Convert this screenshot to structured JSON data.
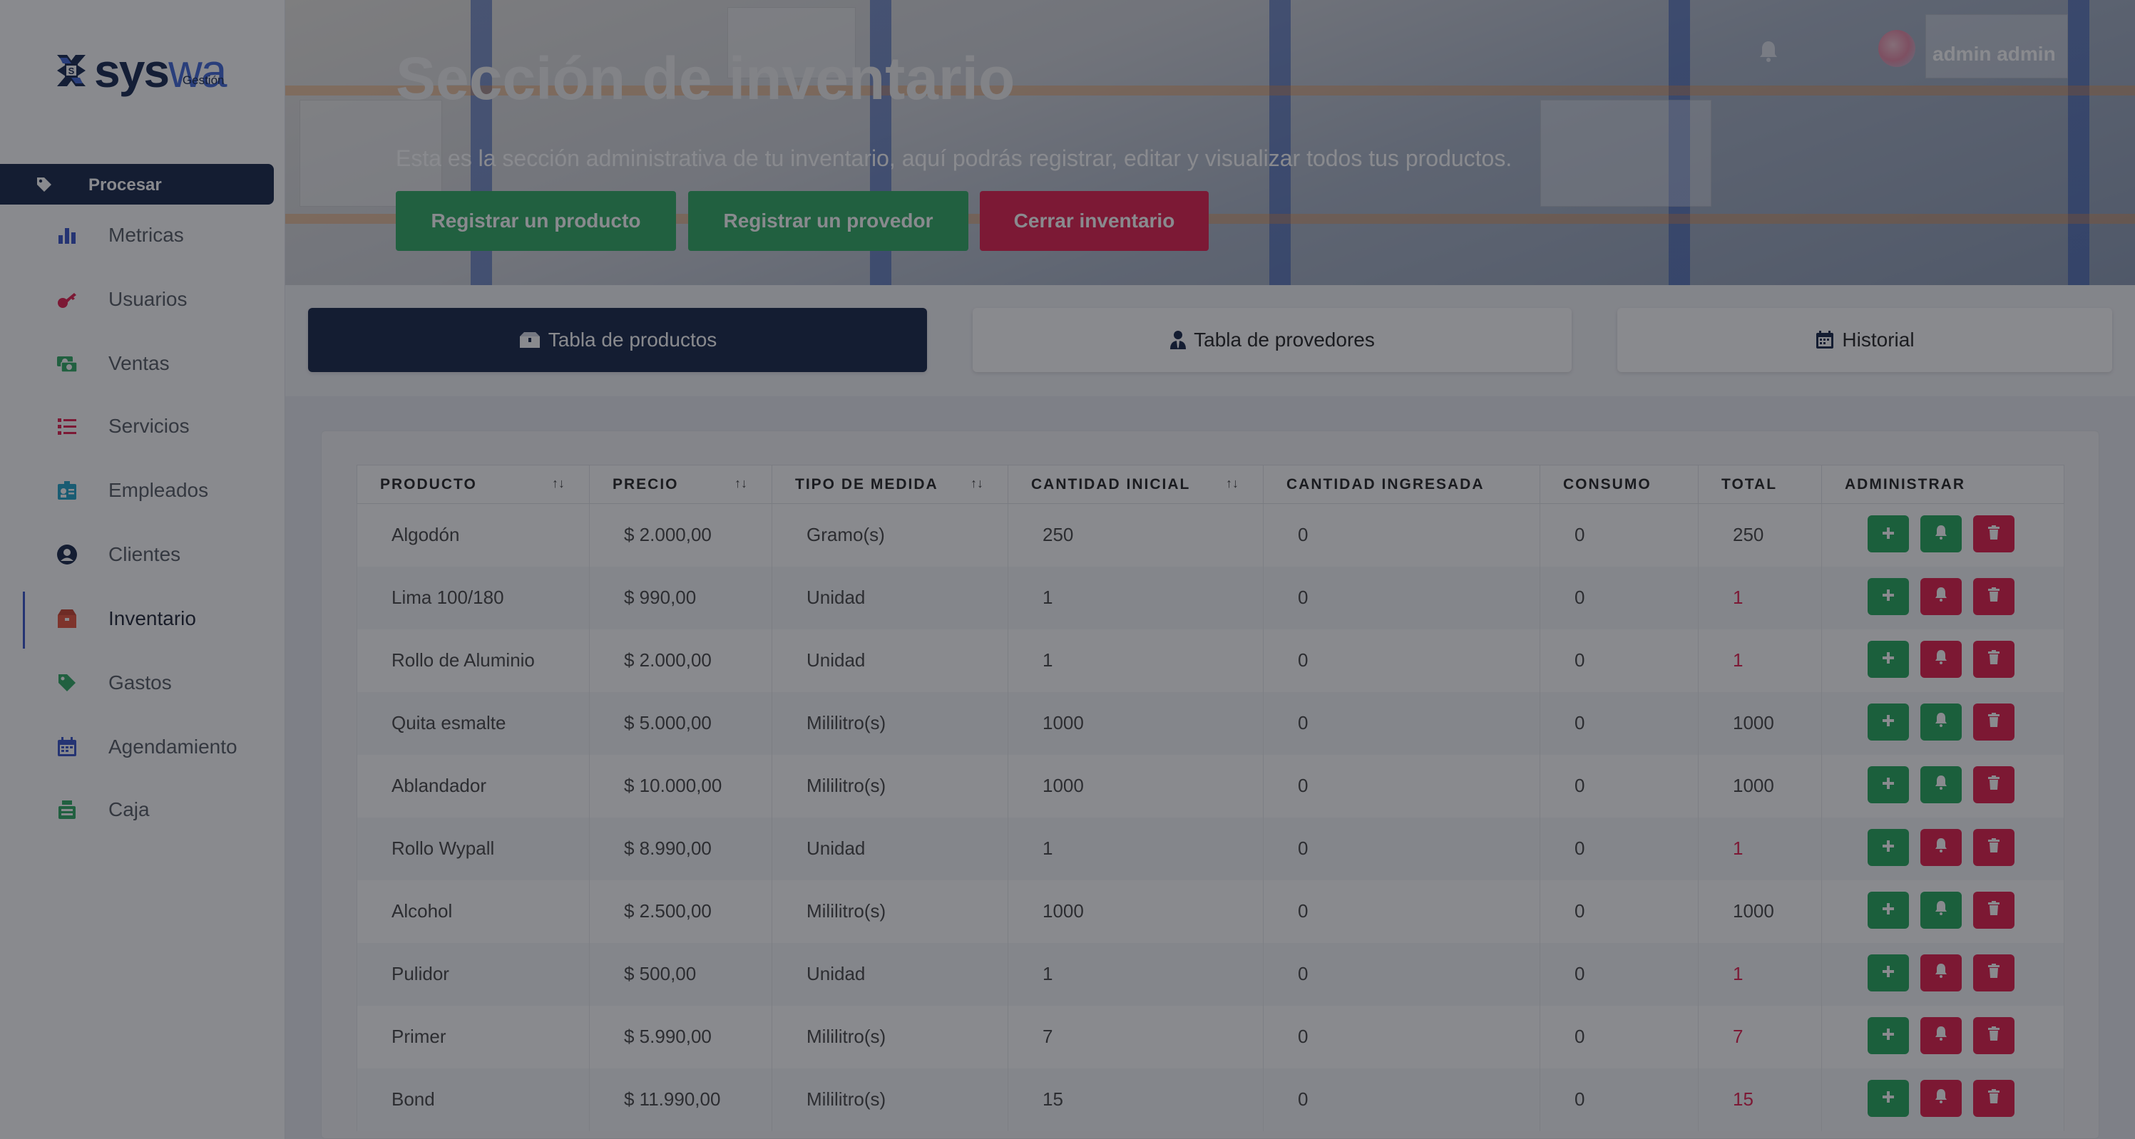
{
  "brand": {
    "name_part1": "sys",
    "name_part2": "wa",
    "sub": "Gestión"
  },
  "sidebar": {
    "procesar_label": "Procesar",
    "items": [
      {
        "label": "Metricas",
        "icon": "bar-chart-icon",
        "color": "#3652c8"
      },
      {
        "label": "Usuarios",
        "icon": "users-key-icon",
        "color": "#e51d4c"
      },
      {
        "label": "Ventas",
        "icon": "money-icon",
        "color": "#2eaa62"
      },
      {
        "label": "Servicios",
        "icon": "list-icon",
        "color": "#e51d4c"
      },
      {
        "label": "Empleados",
        "icon": "id-badge-icon",
        "color": "#1fa3c8"
      },
      {
        "label": "Clientes",
        "icon": "user-circle-icon",
        "color": "#152446"
      },
      {
        "label": "Inventario",
        "icon": "box-icon",
        "color": "#e8533a"
      },
      {
        "label": "Gastos",
        "icon": "tag-icon",
        "color": "#2eaa62"
      },
      {
        "label": "Agendamiento",
        "icon": "calendar-icon",
        "color": "#3652c8"
      },
      {
        "label": "Caja",
        "icon": "cash-register-icon",
        "color": "#2eaa62"
      }
    ],
    "active": "Inventario"
  },
  "header": {
    "title": "Sección de inventario",
    "subtitle": "Esta es la sección administrativa de tu inventario, aquí podrás registrar, editar y visualizar todos tus productos.",
    "buttons": {
      "register_product": "Registrar un producto",
      "register_provider": "Registrar un provedor",
      "close_inventory": "Cerrar inventario"
    },
    "user": "admin admin"
  },
  "tabs": {
    "products": "Tabla de productos",
    "providers": "Tabla de provedores",
    "history": "Historial"
  },
  "table": {
    "columns": [
      "PRODUCTO",
      "PRECIO",
      "TIPO DE MEDIDA",
      "CANTIDAD INICIAL",
      "CANTIDAD INGRESADA",
      "CONSUMO",
      "TOTAL",
      "ADMINISTRAR"
    ],
    "sort_glyph": "↑↓",
    "rows": [
      {
        "producto": "Algodón",
        "precio": "$ 2.000,00",
        "medida": "Gramo(s)",
        "inicial": "250",
        "ingresada": "0",
        "consumo": "0",
        "total": "250",
        "low": false
      },
      {
        "producto": "Lima 100/180",
        "precio": "$ 990,00",
        "medida": "Unidad",
        "inicial": "1",
        "ingresada": "0",
        "consumo": "0",
        "total": "1",
        "low": true
      },
      {
        "producto": "Rollo de Aluminio",
        "precio": "$ 2.000,00",
        "medida": "Unidad",
        "inicial": "1",
        "ingresada": "0",
        "consumo": "0",
        "total": "1",
        "low": true
      },
      {
        "producto": "Quita esmalte",
        "precio": "$ 5.000,00",
        "medida": "Mililitro(s)",
        "inicial": "1000",
        "ingresada": "0",
        "consumo": "0",
        "total": "1000",
        "low": false
      },
      {
        "producto": "Ablandador",
        "precio": "$ 10.000,00",
        "medida": "Mililitro(s)",
        "inicial": "1000",
        "ingresada": "0",
        "consumo": "0",
        "total": "1000",
        "low": false
      },
      {
        "producto": "Rollo Wypall",
        "precio": "$ 8.990,00",
        "medida": "Unidad",
        "inicial": "1",
        "ingresada": "0",
        "consumo": "0",
        "total": "1",
        "low": true
      },
      {
        "producto": "Alcohol",
        "precio": "$ 2.500,00",
        "medida": "Mililitro(s)",
        "inicial": "1000",
        "ingresada": "0",
        "consumo": "0",
        "total": "1000",
        "low": false
      },
      {
        "producto": "Pulidor",
        "precio": "$ 500,00",
        "medida": "Unidad",
        "inicial": "1",
        "ingresada": "0",
        "consumo": "0",
        "total": "1",
        "low": true
      },
      {
        "producto": "Primer",
        "precio": "$ 5.990,00",
        "medida": "Mililitro(s)",
        "inicial": "7",
        "ingresada": "0",
        "consumo": "0",
        "total": "7",
        "low": true
      },
      {
        "producto": "Bond",
        "precio": "$ 11.990,00",
        "medida": "Mililitro(s)",
        "inicial": "15",
        "ingresada": "0",
        "consumo": "0",
        "total": "15",
        "low": true
      }
    ]
  },
  "colors": {
    "navy": "#152446",
    "green": "#2eaa62",
    "red": "#e51d4c",
    "accent": "#3652c8"
  }
}
